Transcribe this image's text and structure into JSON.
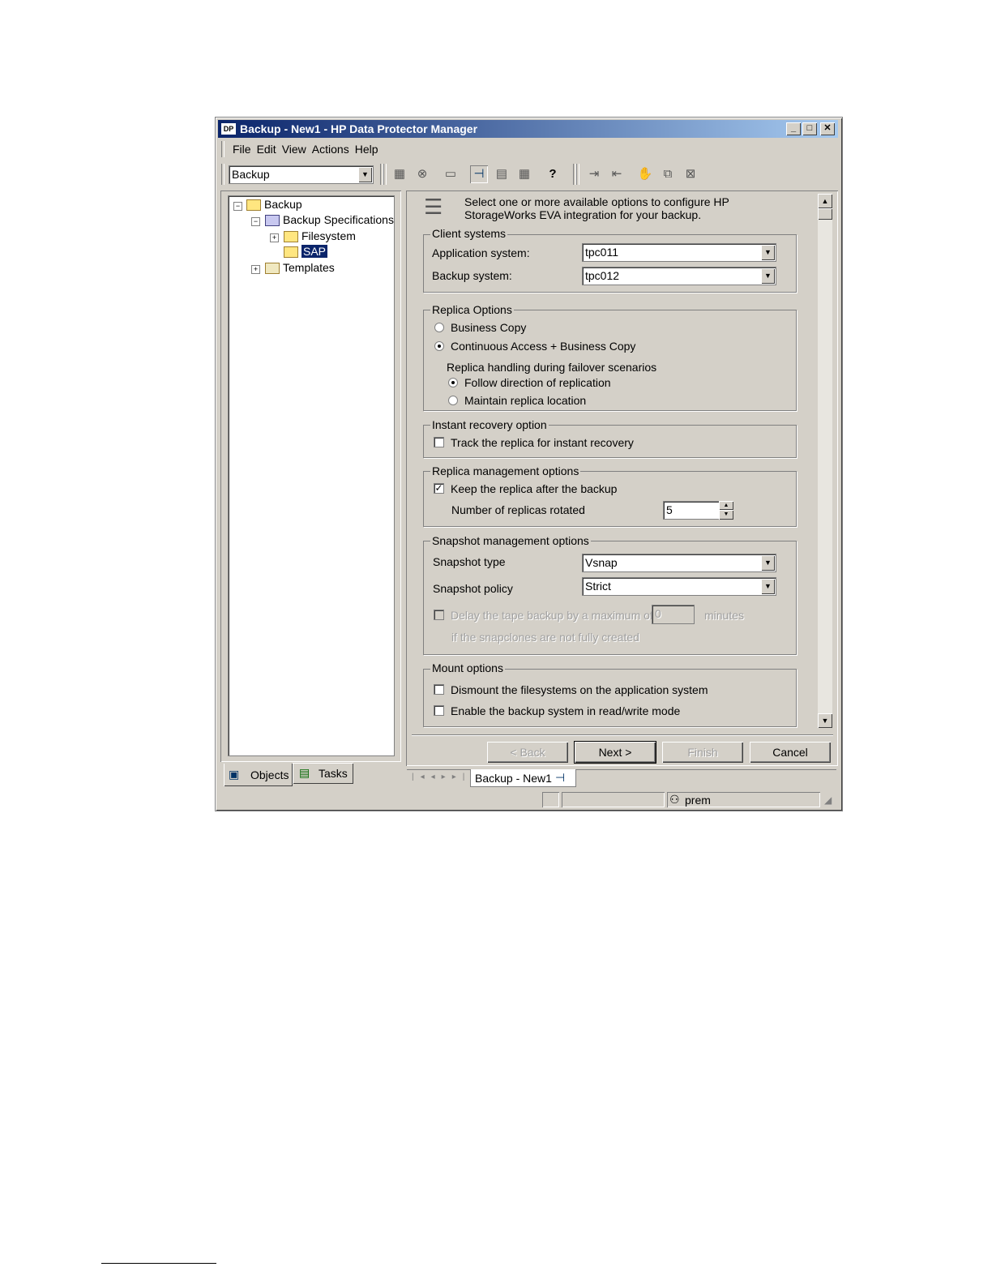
{
  "window": {
    "title": "Backup - New1 - HP Data Protector Manager",
    "app_icon_text": "DP",
    "controls": {
      "minimize": "_",
      "maximize": "□",
      "close": "✕"
    }
  },
  "menu": {
    "file": "File",
    "edit": "Edit",
    "view": "View",
    "actions": "Actions",
    "help": "Help"
  },
  "toolbar": {
    "context_value": "Backup",
    "icons": [
      "clients-icon",
      "stop-icon",
      "window-icon",
      "pin-icon",
      "list-icon",
      "calendar-icon",
      "help-icon",
      "import-icon",
      "export-icon",
      "hand-icon",
      "cascade-icon",
      "tile-icon"
    ],
    "help_glyph": "?"
  },
  "tree": {
    "root": "Backup",
    "specs": "Backup Specifications",
    "filesystem": "Filesystem",
    "sap": "SAP",
    "templates": "Templates",
    "expand": "+",
    "collapse": "−"
  },
  "left_tabs": {
    "objects": "Objects",
    "tasks": "Tasks"
  },
  "wizard": {
    "intro": "Select one or more available options to configure HP StorageWorks EVA integration for your backup.",
    "client_systems": {
      "title": "Client systems",
      "app_label": "Application system:",
      "app_value": "tpc011",
      "backup_label": "Backup system:",
      "backup_value": "tpc012"
    },
    "replica_options": {
      "title": "Replica Options",
      "business_copy": "Business Copy",
      "ca_bc": "Continuous Access + Business Copy",
      "failover_label": "Replica handling during failover scenarios",
      "follow": "Follow direction of replication",
      "maintain": "Maintain replica location",
      "selected": "ca_bc",
      "failover_selected": "follow"
    },
    "instant_recovery": {
      "title": "Instant recovery option",
      "track": "Track the replica for instant recovery",
      "checked": false
    },
    "replica_management": {
      "title": "Replica management options",
      "keep": "Keep the replica after the backup",
      "keep_checked": true,
      "rotated_label": "Number of replicas rotated",
      "rotated_value": "5"
    },
    "snapshot_management": {
      "title": "Snapshot management options",
      "type_label": "Snapshot type",
      "type_value": "Vsnap",
      "policy_label": "Snapshot policy",
      "policy_value": "Strict",
      "delay_label": "Delay the tape backup by a maximum of",
      "delay_value": "0",
      "delay_unit": "minutes",
      "delay_note": "if the snapclones are not fully created"
    },
    "mount_options": {
      "title": "Mount options",
      "dismount": "Dismount the filesystems on the application system",
      "enable_rw": "Enable the backup system in read/write mode"
    },
    "buttons": {
      "back": "< Back",
      "next": "Next >",
      "finish": "Finish",
      "cancel": "Cancel"
    }
  },
  "bottom_tab": {
    "label": "Backup - New1",
    "nav": [
      "|◂",
      "◂",
      "▸",
      "▸|"
    ]
  },
  "status": {
    "user": "prem"
  }
}
